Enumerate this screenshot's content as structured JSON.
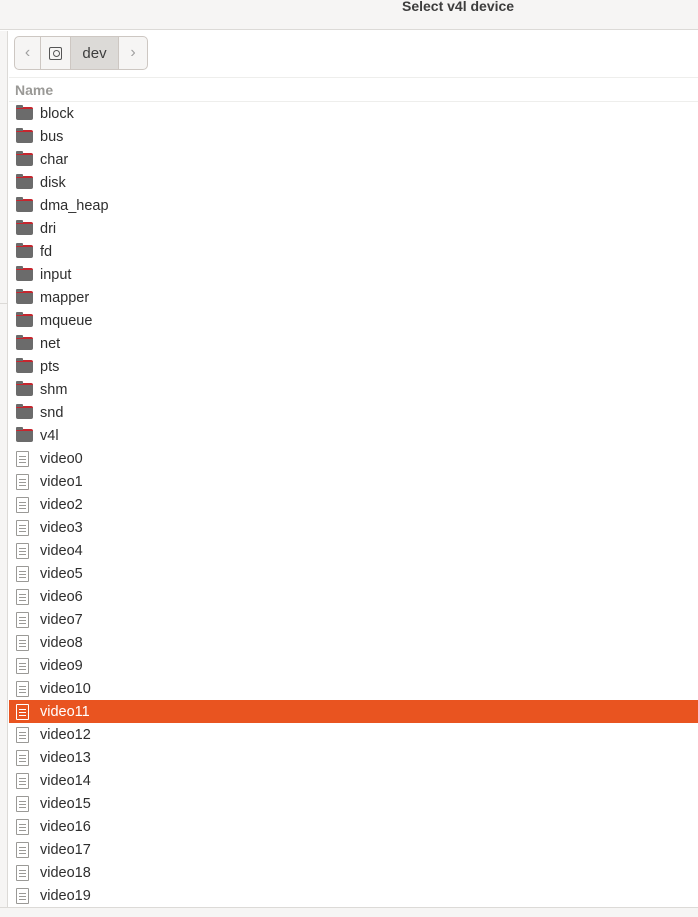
{
  "window": {
    "title": "Select v4l device"
  },
  "pathbar": {
    "back_glyph": "‹",
    "forward_glyph": "›",
    "root_icon": "disk-icon",
    "current": "dev"
  },
  "list": {
    "column_name": "Name",
    "items": [
      {
        "name": "block",
        "type": "folder"
      },
      {
        "name": "bus",
        "type": "folder"
      },
      {
        "name": "char",
        "type": "folder"
      },
      {
        "name": "disk",
        "type": "folder"
      },
      {
        "name": "dma_heap",
        "type": "folder"
      },
      {
        "name": "dri",
        "type": "folder"
      },
      {
        "name": "fd",
        "type": "folder"
      },
      {
        "name": "input",
        "type": "folder"
      },
      {
        "name": "mapper",
        "type": "folder"
      },
      {
        "name": "mqueue",
        "type": "folder"
      },
      {
        "name": "net",
        "type": "folder"
      },
      {
        "name": "pts",
        "type": "folder"
      },
      {
        "name": "shm",
        "type": "folder"
      },
      {
        "name": "snd",
        "type": "folder"
      },
      {
        "name": "v4l",
        "type": "folder"
      },
      {
        "name": "video0",
        "type": "file"
      },
      {
        "name": "video1",
        "type": "file"
      },
      {
        "name": "video2",
        "type": "file"
      },
      {
        "name": "video3",
        "type": "file"
      },
      {
        "name": "video4",
        "type": "file"
      },
      {
        "name": "video5",
        "type": "file"
      },
      {
        "name": "video6",
        "type": "file"
      },
      {
        "name": "video7",
        "type": "file"
      },
      {
        "name": "video8",
        "type": "file"
      },
      {
        "name": "video9",
        "type": "file"
      },
      {
        "name": "video10",
        "type": "file"
      },
      {
        "name": "video11",
        "type": "file",
        "selected": true
      },
      {
        "name": "video12",
        "type": "file"
      },
      {
        "name": "video13",
        "type": "file"
      },
      {
        "name": "video14",
        "type": "file"
      },
      {
        "name": "video15",
        "type": "file"
      },
      {
        "name": "video16",
        "type": "file"
      },
      {
        "name": "video17",
        "type": "file"
      },
      {
        "name": "video18",
        "type": "file"
      },
      {
        "name": "video19",
        "type": "file"
      }
    ]
  },
  "colors": {
    "selection": "#e95420",
    "folder_accent": "#c6262e"
  }
}
